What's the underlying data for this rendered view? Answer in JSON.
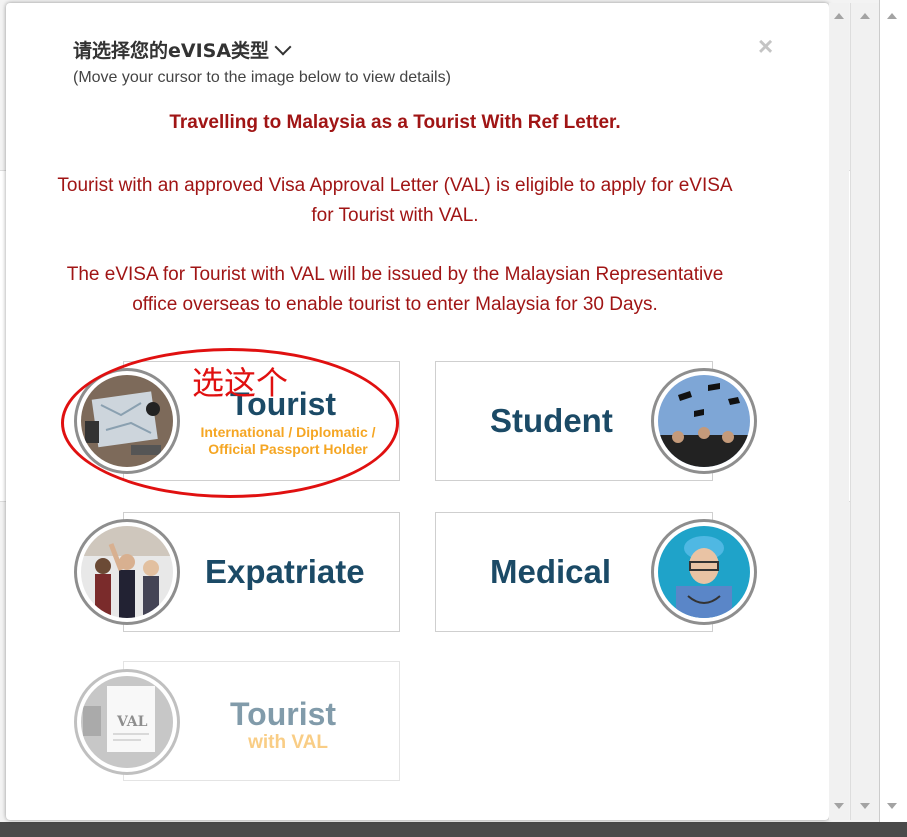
{
  "modal": {
    "title": "请选择您的eVISA类型",
    "subtitle": "(Move your cursor to the image below to view details)",
    "close_symbol": "×",
    "heading": "Travelling to Malaysia as a Tourist With Ref Letter.",
    "paragraph1": "Tourist with an approved Visa Approval Letter (VAL) is eligible to apply for eVISA for Tourist with VAL.",
    "paragraph2": "The eVISA for Tourist with VAL will be issued by the Malaysian Representative office overseas to enable tourist to enter Malaysia for 30 Days."
  },
  "cards": {
    "tourist": {
      "title": "Tourist",
      "sub_line1": "International / Diplomatic /",
      "sub_line2": "Official Passport Holder"
    },
    "student": {
      "title": "Student"
    },
    "expatriate": {
      "title": "Expatriate"
    },
    "medical": {
      "title": "Medical"
    },
    "tourist_val": {
      "title": "Tourist",
      "sub": "with VAL",
      "badge": "VAL"
    }
  },
  "annotation": {
    "text": "选这个",
    "color": "#e01010"
  },
  "colors": {
    "red_text": "#a01515",
    "card_title": "#1b4a66",
    "card_sub": "#f5a623"
  },
  "icons": [
    "chevron-down-icon",
    "close-icon",
    "scroll-up-icon",
    "scroll-down-icon"
  ]
}
